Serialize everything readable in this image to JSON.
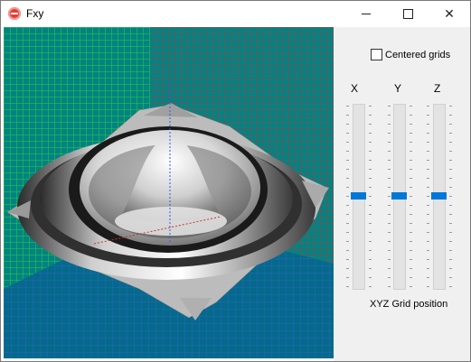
{
  "window": {
    "title": "Fxy",
    "controls": {
      "minimize": "minimize",
      "maximize": "maximize",
      "close": "✕"
    }
  },
  "viewport": {
    "background": "#028383",
    "grid_colors": {
      "left_wall": "#33cc33",
      "back_wall": "#cc3333",
      "floor": "#1a5fcc"
    }
  },
  "panel": {
    "centered_grids": {
      "label": "Centered grids",
      "checked": false
    },
    "sliders": [
      {
        "axis": "X",
        "value": 0.5
      },
      {
        "axis": "Y",
        "value": 0.5
      },
      {
        "axis": "Z",
        "value": 0.5
      }
    ],
    "caption": "XYZ Grid position",
    "accent": "#0078d7"
  }
}
